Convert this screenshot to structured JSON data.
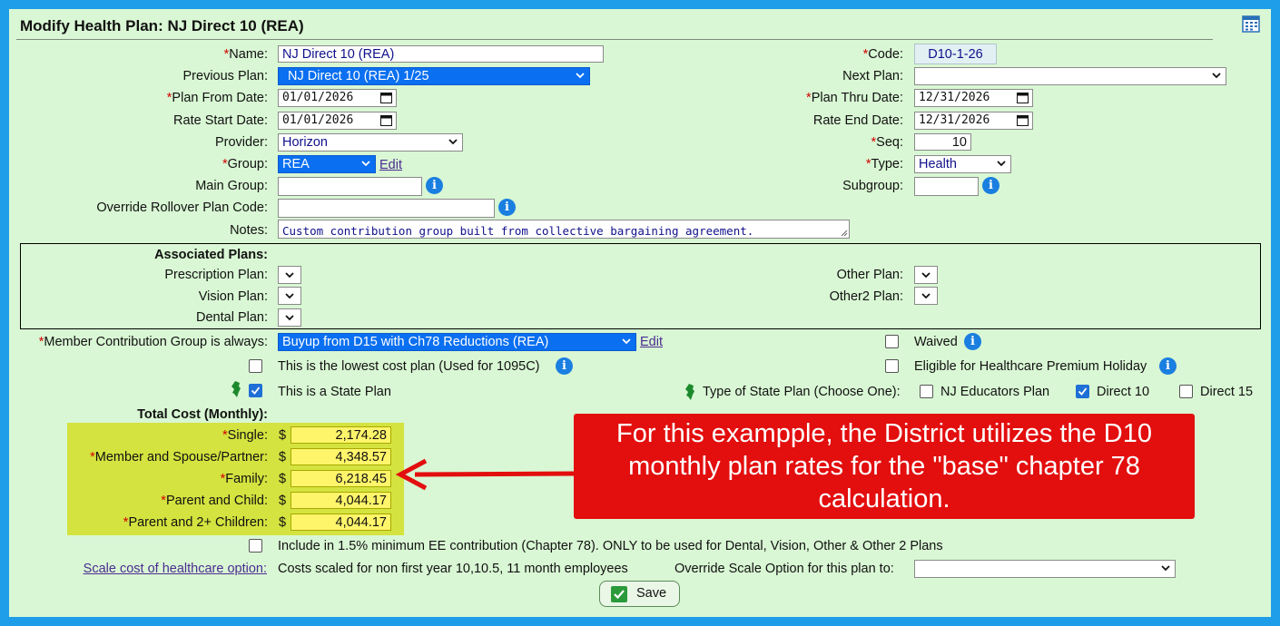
{
  "window": {
    "title": "Modify Health Plan: NJ Direct 10 (REA)"
  },
  "form": {
    "name_label": "Name:",
    "name_value": "NJ Direct 10 (REA)",
    "code_label": "Code:",
    "code_value": "D10-1-26",
    "prev_plan_label": "Previous Plan:",
    "prev_plan_value": "NJ Direct 10 (REA) 1/25",
    "next_plan_label": "Next Plan:",
    "next_plan_value": "",
    "plan_from_label": "Plan From Date:",
    "plan_from_value": "01/01/2026",
    "plan_thru_label": "Plan Thru Date:",
    "plan_thru_value": "12/31/2026",
    "rate_start_label": "Rate Start Date:",
    "rate_start_value": "01/01/2026",
    "rate_end_label": "Rate End Date:",
    "rate_end_value": "12/31/2026",
    "provider_label": "Provider:",
    "provider_value": "Horizon",
    "seq_label": "Seq:",
    "seq_value": "10",
    "group_label": "Group:",
    "group_value": "REA",
    "group_edit": "Edit",
    "type_label": "Type:",
    "type_value": "Health",
    "main_group_label": "Main Group:",
    "subgroup_label": "Subgroup:",
    "override_rollover_label": "Override Rollover Plan Code:",
    "notes_label": "Notes:",
    "notes_value": "Custom contribution group built from collective bargaining agreement."
  },
  "associated": {
    "heading": "Associated Plans:",
    "prescription_label": "Prescription Plan:",
    "vision_label": "Vision Plan:",
    "dental_label": "Dental Plan:",
    "other_label": "Other Plan:",
    "other2_label": "Other2 Plan:"
  },
  "contribution": {
    "label": "Member Contribution Group is always:",
    "value": "Buyup from D15 with Ch78 Reductions (REA)",
    "edit": "Edit",
    "waived_label": "Waived",
    "lowest_cost_label": "This is the lowest cost plan (Used for 1095C)",
    "holiday_label": "Eligible for Healthcare Premium Holiday",
    "state_plan_label": "This is a State Plan",
    "state_type_label": "Type of State Plan (Choose One):",
    "nj_educators_label": "NJ Educators Plan",
    "direct10_label": "Direct 10",
    "direct15_label": "Direct 15"
  },
  "costs": {
    "heading": "Total Cost (Monthly):",
    "currency": "$",
    "rows": [
      {
        "label": "Single:",
        "value": "2,174.28"
      },
      {
        "label": "Member and Spouse/Partner:",
        "value": "4,348.57"
      },
      {
        "label": "Family:",
        "value": "6,218.45"
      },
      {
        "label": "Parent and Child:",
        "value": "4,044.17"
      },
      {
        "label": "Parent and 2+ Children:",
        "value": "4,044.17"
      }
    ]
  },
  "callout": {
    "line1": "For this exampple, the District utilizes the D10",
    "line2": "monthly plan rates for the \"base\" chapter 78",
    "line3": "calculation."
  },
  "footer": {
    "include_label": "Include in 1.5% minimum EE contribution (Chapter 78). ONLY to be used for Dental, Vision, Other & Other 2 Plans",
    "scale_link": "Scale cost of healthcare option:",
    "scale_text": "Costs scaled for non first year 10,10.5, 11 month employees",
    "override_scale_label": "Override Scale Option for this plan to:",
    "save_label": "Save"
  },
  "colors": {
    "frame": "#1e9ee9",
    "panel": "#d9f7d4",
    "callout": "#e30e0e",
    "selected_select": "#0a6ff0",
    "cost_block": "#d4e33f"
  }
}
